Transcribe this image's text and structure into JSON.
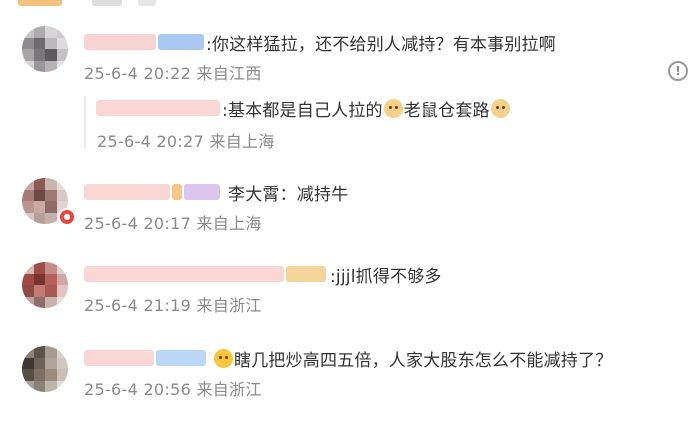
{
  "comments": [
    {
      "text": ":你这样猛拉，还不给别人减持？有本事别拉啊",
      "meta": "25-6-4 20:22 来自江西",
      "reply": {
        "text": ":基本都是自己人拉的",
        "text2": "老鼠仓套路",
        "meta": "25-6-4 20:27 来自上海"
      }
    },
    {
      "text": "李大霄：减持牛",
      "meta": "25-6-4 20:17 来自上海"
    },
    {
      "text": ":jjjl抓得不够多",
      "meta": "25-6-4 21:19 来自浙江"
    },
    {
      "text": "瞎几把炒高四五倍，人家大股东怎么不能减持了？",
      "meta": "25-6-4 20:56 来自浙江"
    }
  ],
  "icons": {
    "alert": "alert-circle-icon",
    "dog": "dog-emoji-icon",
    "smile": "smile-emoji-icon"
  },
  "colors": {
    "text": "#333333",
    "meta": "#8a8a8a",
    "badge": "#e8473e"
  }
}
